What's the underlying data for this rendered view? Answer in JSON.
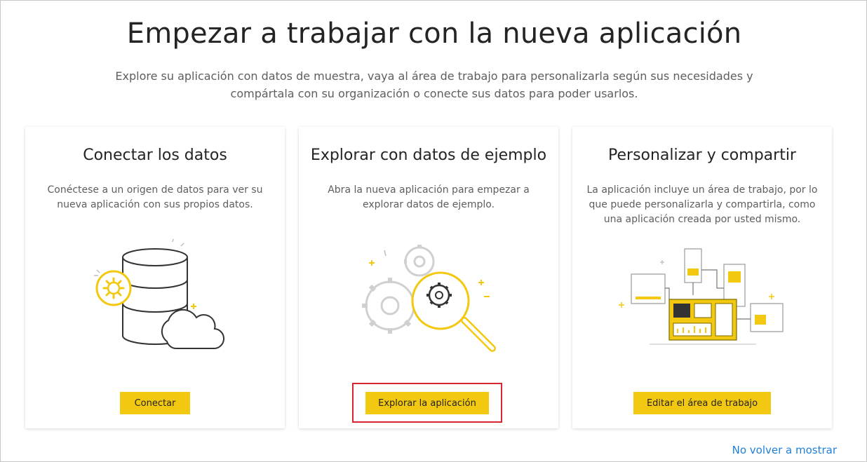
{
  "header": {
    "title": "Empezar a trabajar con la nueva aplicación",
    "subtitle": "Explore su aplicación con datos de muestra, vaya al área de trabajo para personalizarla según sus necesidades y compártala con su organización o conecte sus datos para poder usarlos."
  },
  "cards": [
    {
      "title": "Conectar los datos",
      "description": "Conéctese a un origen de datos para ver su nueva aplicación con sus propios datos.",
      "button_label": "Conectar",
      "illustration": "database-cloud-gear-icon"
    },
    {
      "title": "Explorar con datos de ejemplo",
      "description": "Abra la nueva aplicación para empezar a explorar datos de ejemplo.",
      "button_label": "Explorar la aplicación",
      "illustration": "magnifier-gears-icon"
    },
    {
      "title": "Personalizar y compartir",
      "description": "La aplicación incluye un área de trabajo, por lo que puede personalizarla y compartirla, como una aplicación creada por usted mismo.",
      "button_label": "Editar el área de trabajo",
      "illustration": "dashboard-workspace-icon"
    }
  ],
  "footer": {
    "dismiss_link": "No volver a mostrar"
  },
  "colors": {
    "accent": "#f2c811",
    "highlight_border": "#d6262f",
    "link": "#1f7fd6"
  }
}
